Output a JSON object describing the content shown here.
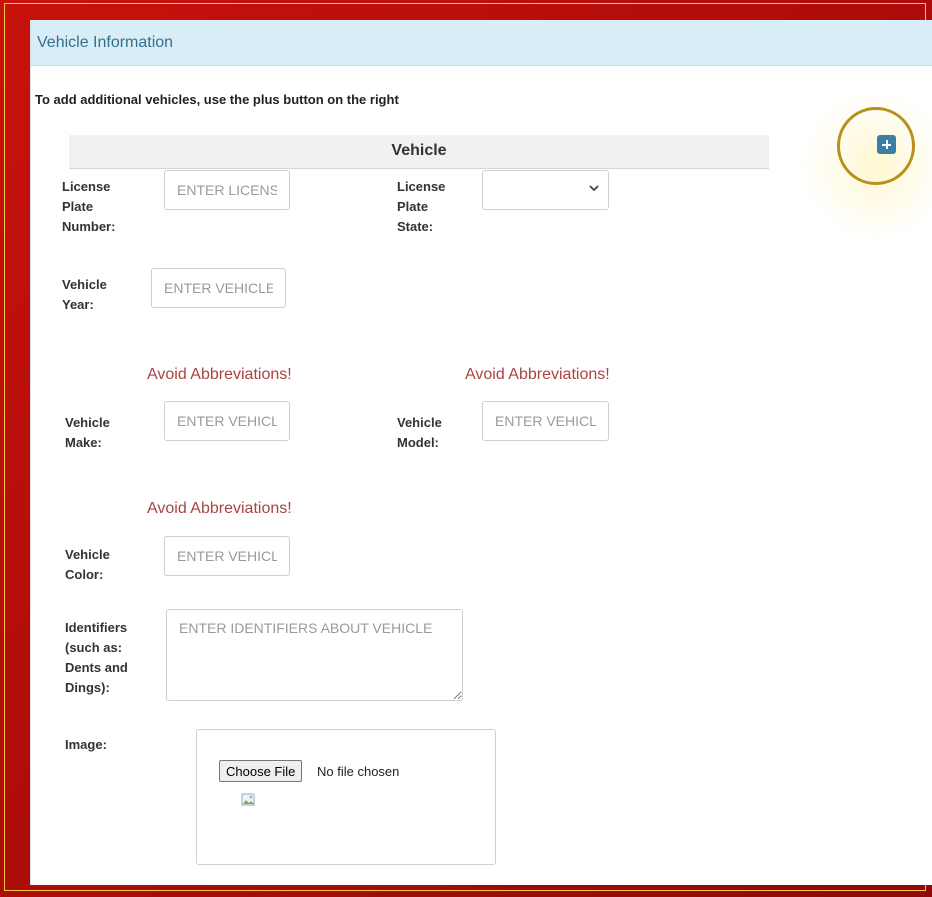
{
  "panel": {
    "title": "Vehicle Information",
    "intro": "To add additional vehicles, use the plus button on the right"
  },
  "section": {
    "title": "Vehicle"
  },
  "icons": {
    "add": "plus-icon",
    "select_arrow": "chevron-down-icon",
    "image": "broken-image-icon"
  },
  "colors": {
    "header_bg": "#d9edf7",
    "header_text": "#31708f",
    "warning": "#a94442",
    "plus_button": "#3a7fa5",
    "ring": "#b8901c"
  },
  "fields": {
    "license_plate_number": {
      "label": [
        "License",
        "Plate",
        "Number:"
      ],
      "placeholder": "ENTER LICENSE PLATE NUMBER"
    },
    "license_plate_state": {
      "label": [
        "License",
        "Plate",
        "State:"
      ],
      "value": ""
    },
    "vehicle_year": {
      "label": [
        "Vehicle",
        "Year:"
      ],
      "placeholder": "ENTER VEHICLE YEAR"
    },
    "vehicle_make": {
      "label": [
        "Vehicle",
        "Make:"
      ],
      "placeholder": "ENTER VEHICLE MAKE",
      "warning": "Avoid Abbreviations!"
    },
    "vehicle_model": {
      "label": [
        "Vehicle",
        "Model:"
      ],
      "placeholder": "ENTER VEHICLE MODEL",
      "warning": "Avoid Abbreviations!"
    },
    "vehicle_color": {
      "label": [
        "Vehicle",
        "Color:"
      ],
      "placeholder": "ENTER VEHICLE COLOR",
      "warning": "Avoid Abbreviations!"
    },
    "identifiers": {
      "label": [
        "Identifiers",
        "(such as:",
        "Dents and",
        "Dings):"
      ],
      "placeholder": "ENTER IDENTIFIERS ABOUT VEHICLE"
    },
    "image": {
      "label": "Image:",
      "button": "Choose File",
      "status": "No file chosen"
    }
  }
}
